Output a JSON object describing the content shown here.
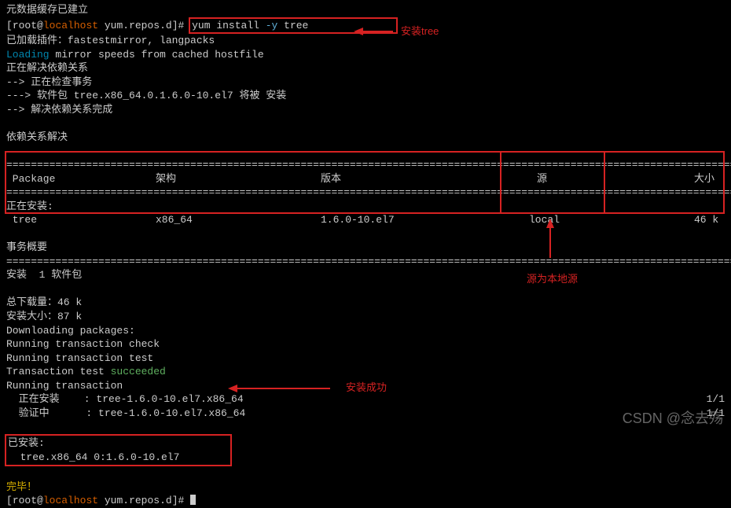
{
  "term": {
    "meta_cache": "元数据缓存已建立",
    "prompt_user": "root",
    "prompt_host": "localhost",
    "prompt_path": "yum.repos.d",
    "cmd_prefix": "yum install ",
    "cmd_opt": "-y",
    "cmd_target": " tree",
    "loaded_plugins": "已加载插件：fastestmirror, langpacks",
    "loading_label": "Loading",
    "loading_rest": " mirror speeds from cached hostfile",
    "resolving": "正在解决依赖关系",
    "checking": "--> 正在检查事务",
    "pkg_line": "---> 软件包 tree.x86_64.0.1.6.0-10.el7 将被 安装",
    "resolve_done": "--> 解决依赖关系完成",
    "dep_resolved": "依赖关系解决",
    "sep": "================================================================================================================================",
    "hdr_package": " Package",
    "hdr_arch": "架构",
    "hdr_version": "版本",
    "hdr_source": "源",
    "hdr_size": "大小",
    "installing_label": "正在安装:",
    "row_pkg": " tree",
    "row_arch": "x86_64",
    "row_ver": "1.6.0-10.el7",
    "row_src": "local",
    "row_size": "46 k",
    "txn_summary": "事务概要",
    "install_count": "安装  1 软件包",
    "dl_size": "总下载量：46 k",
    "inst_size": "安装大小：87 k",
    "dl_pkgs": "Downloading packages:",
    "run_check": "Running transaction check",
    "run_test": "Running transaction test",
    "test_label": "Transaction test ",
    "test_result": "succeeded",
    "run_txn": "Running transaction",
    "installing_row": "  正在安装    : tree-1.6.0-10.el7.x86_64",
    "verifying_row": "  验证中      : tree-1.6.0-10.el7.x86_64",
    "count_11": "1/1",
    "installed_label": "已安装:",
    "installed_pkg": "  tree.x86_64 0:1.6.0-10.el7",
    "complete": "完毕！"
  },
  "anno": {
    "install_tree": "安装tree",
    "local_source": "源为本地源",
    "install_success": "安装成功"
  },
  "watermark": "CSDN @念去殇"
}
